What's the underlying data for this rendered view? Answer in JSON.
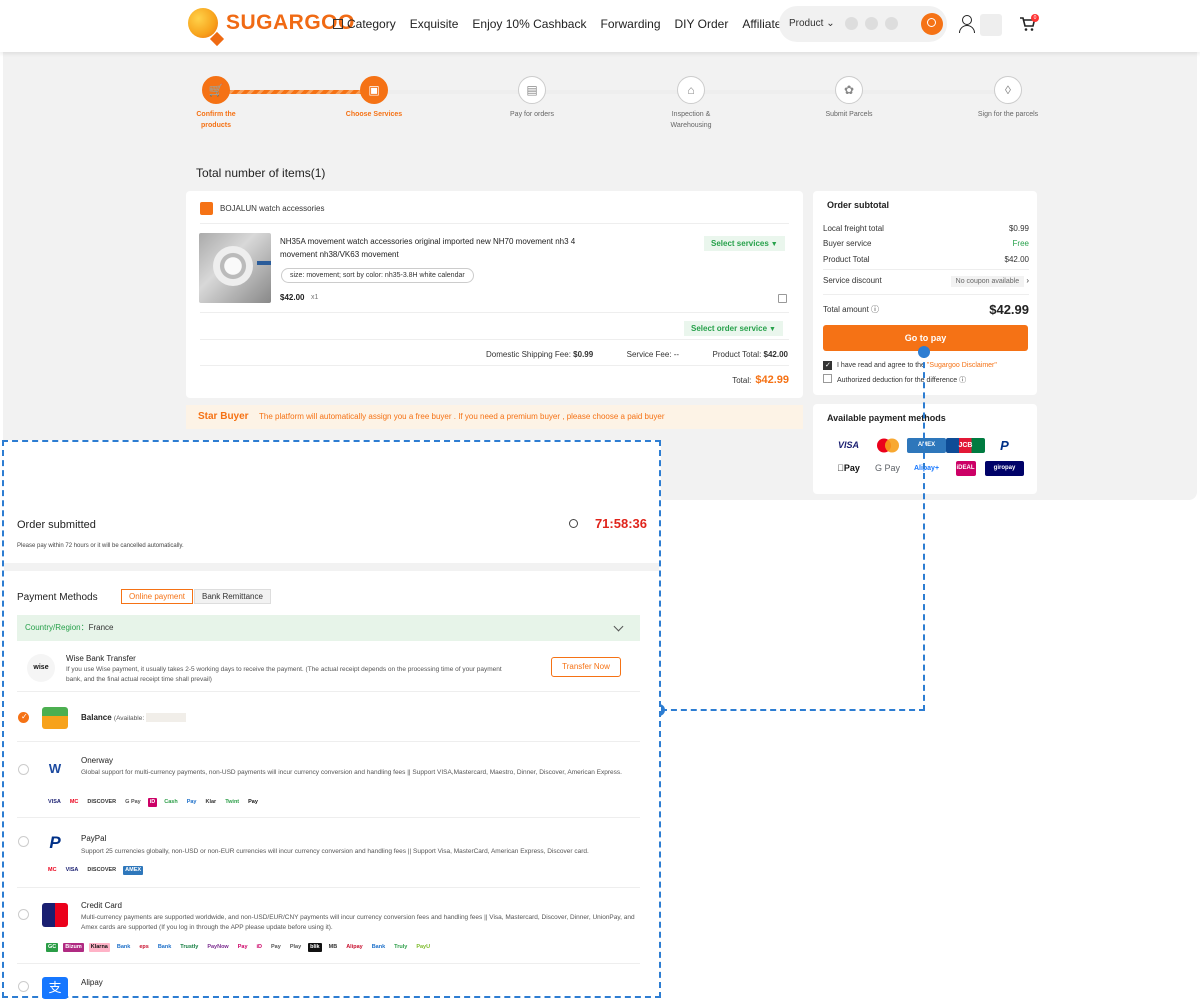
{
  "header": {
    "logo_a": "SUGAR",
    "logo_b": "GOO",
    "nav": [
      "Category",
      "Exquisite",
      "Enjoy 10% Cashback",
      "Forwarding",
      "DIY Order",
      "Affiliate & Refer"
    ],
    "search_scope": "Product",
    "cart_count": "0"
  },
  "steps": [
    "Confirm the products",
    "Choose Services",
    "Pay for orders",
    "Inspection & Warehousing",
    "Submit Parcels",
    "Sign for the parcels"
  ],
  "cart": {
    "total_items": "Total number of items(1)",
    "store": "BOJALUN watch accessories",
    "product_title": "NH35A movement watch accessories original imported new NH70 movement nh3 4 movement nh38/VK63 movement",
    "sku": "size: movement; sort by color: nh35-3.8H white calendar",
    "price": "$42.00",
    "qty": "x1",
    "select_services": "Select services",
    "select_order_service": "Select order service",
    "domestic_label": "Domestic Shipping Fee:",
    "domestic_value": "$0.99",
    "service_label": "Service Fee:",
    "service_value": "--",
    "product_total_label": "Product Total:",
    "product_total_value": "$42.00",
    "total_label": "Total:",
    "total_value": "$42.99"
  },
  "star_buyer": {
    "title": "Star Buyer",
    "text": "The platform will automatically assign you a free buyer . If you need a premium buyer , please choose a paid buyer"
  },
  "summary": {
    "title": "Order subtotal",
    "rows": [
      {
        "label": "Local freight total",
        "value": "$0.99"
      },
      {
        "label": "Buyer service",
        "value": "Free"
      },
      {
        "label": "Product Total",
        "value": "$42.00"
      }
    ],
    "discount_label": "Service discount",
    "discount_value": "No coupon available",
    "total_amount_label": "Total amount",
    "total_amount_value": "$42.99",
    "go_to_pay": "Go to pay",
    "agree_text": "I have read and agree to the",
    "disclaimer": "\"Sugargoo Disclaimer\"",
    "authorized": "Authorized deduction for the difference"
  },
  "payment_methods_card": {
    "title": "Available payment methods",
    "items": [
      "VISA",
      "MC",
      "AMEX",
      "JCB",
      "P",
      "Pay",
      "G Pay",
      "Alipay+",
      "iDEAL",
      "giropay"
    ]
  },
  "order": {
    "title": "Order submitted",
    "timer": "71:58:36",
    "subtitle": "Please pay within 72 hours or it will be cancelled automatically.",
    "pm_title": "Payment Methods",
    "tabs": [
      "Online payment",
      "Bank Remittance"
    ],
    "country_label": "Country/Region：",
    "country_value": "France",
    "wise": {
      "logo": "wise",
      "title": "Wise Bank Transfer",
      "desc": "If you use Wise payment, it usually takes 2-5 working days to receive the payment. (The actual receipt depends on the processing time of your payment bank, and the final actual receipt time shall prevail)",
      "button": "Transfer Now"
    },
    "balance": {
      "title": "Balance",
      "available": "(Available:"
    },
    "onerway": {
      "title": "Onerway",
      "desc": "Global support for multi-currency payments, non-USD payments will incur currency conversion and handling fees || Support VISA,Mastercard, Maestro, Dinner, Discover, American Express.",
      "logos": [
        "VISA",
        "MC",
        "DISCOVER",
        "G Pay",
        "iD",
        "Cash",
        "Pay",
        "Klar",
        "Twint",
        "Pay"
      ]
    },
    "paypal": {
      "title": "PayPal",
      "desc": "Support 25 currencies globally, non-USD or non-EUR currencies will incur currency conversion and handling fees || Support Visa, MasterCard, American Express, Discover card.",
      "logos": [
        "MC",
        "VISA",
        "DISCOVER",
        "AMEX"
      ]
    },
    "credit": {
      "title": "Credit Card",
      "desc": "Multi-currency payments are supported worldwide, and non-USD/EUR/CNY payments will incur currency conversion fees and handling fees || Visa, Mastercard, Discover, Dinner, UnionPay, and Amex cards are supported (If you log in through the APP please update before using it).",
      "logos": [
        "GC",
        "Bizum",
        "Klarna",
        "Bank",
        "eps",
        "Bank",
        "Trustly",
        "PayNow",
        "Pay",
        "iD",
        "Pay",
        "Play",
        "blik",
        "MB",
        "Alipay",
        "Bank",
        "Truly",
        "PayU"
      ]
    },
    "alipay": {
      "title": "Alipay"
    }
  }
}
